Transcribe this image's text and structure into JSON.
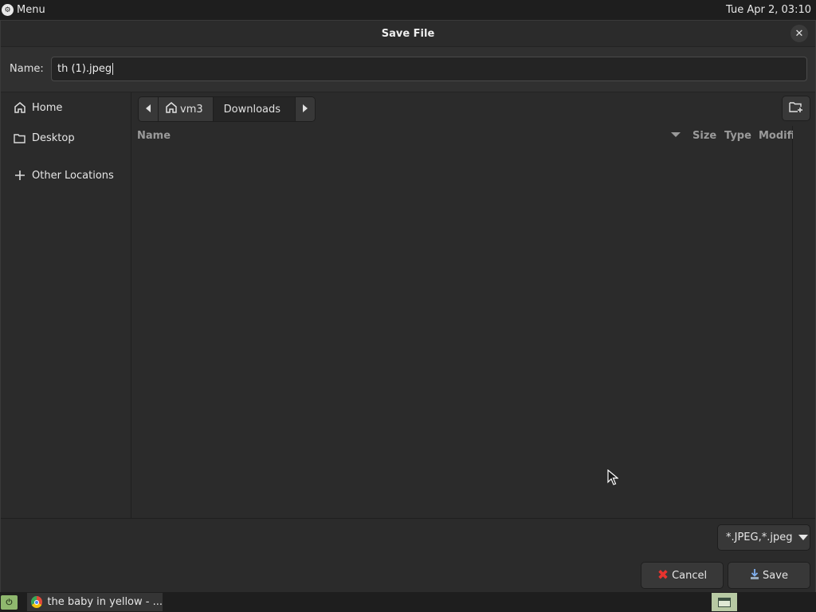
{
  "top_panel": {
    "menu_label": "Menu",
    "clock": "Tue Apr  2, 03:10"
  },
  "dialog": {
    "title": "Save File",
    "name_label": "Name:",
    "name_value": "th (1).jpeg"
  },
  "sidebar": {
    "items": [
      {
        "label": "Home",
        "icon": "home-icon"
      },
      {
        "label": "Desktop",
        "icon": "folder-icon"
      },
      {
        "label": "Other Locations",
        "icon": "plus-icon"
      }
    ]
  },
  "pathbar": {
    "segments": [
      "vm3",
      "Downloads"
    ]
  },
  "file_list": {
    "columns": [
      "Name",
      "Size",
      "Type",
      "Modified"
    ],
    "sort_column": "Name",
    "rows": []
  },
  "bottom": {
    "filter_value": "*.JPEG,*.jpeg",
    "cancel_label": "Cancel",
    "save_label": "Save"
  },
  "taskbar": {
    "task_title": "the baby in yellow - ..."
  },
  "colors": {
    "panel": "#1e1e1e",
    "dialog_bg": "#2b2b2b",
    "cancel_icon": "#e8332e",
    "start_button": "#8fb86e"
  }
}
